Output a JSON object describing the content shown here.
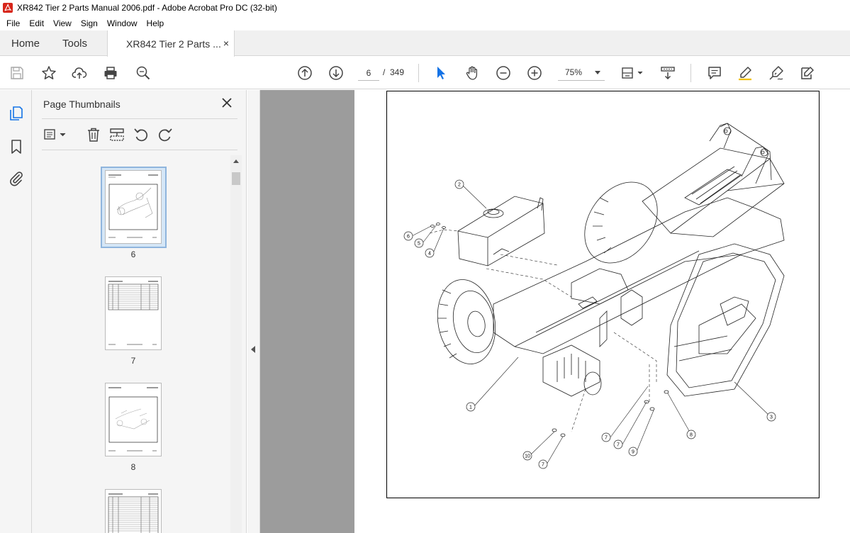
{
  "window": {
    "title": "XR842 Tier 2 Parts Manual 2006.pdf - Adobe Acrobat Pro DC (32-bit)"
  },
  "menu": [
    "File",
    "Edit",
    "View",
    "Sign",
    "Window",
    "Help"
  ],
  "tabs": {
    "home": "Home",
    "tools": "Tools",
    "document": "XR842 Tier 2 Parts ...",
    "close": "×"
  },
  "toolbar": {
    "page_current": "6",
    "page_separator": "/",
    "page_total": "349",
    "zoom": "75%"
  },
  "panel": {
    "title": "Page Thumbnails",
    "thumbnails": [
      {
        "page": "6",
        "selected": true
      },
      {
        "page": "7",
        "selected": false
      },
      {
        "page": "8",
        "selected": false
      }
    ]
  },
  "drawing": {
    "callouts": [
      "1",
      "2",
      "3",
      "4",
      "5",
      "6",
      "7",
      "7",
      "7",
      "8",
      "9",
      "10"
    ]
  },
  "colors": {
    "accent": "#1473e6",
    "document_background": "#9c9c9c",
    "thumbnail_selection": "#d5e6f6"
  }
}
